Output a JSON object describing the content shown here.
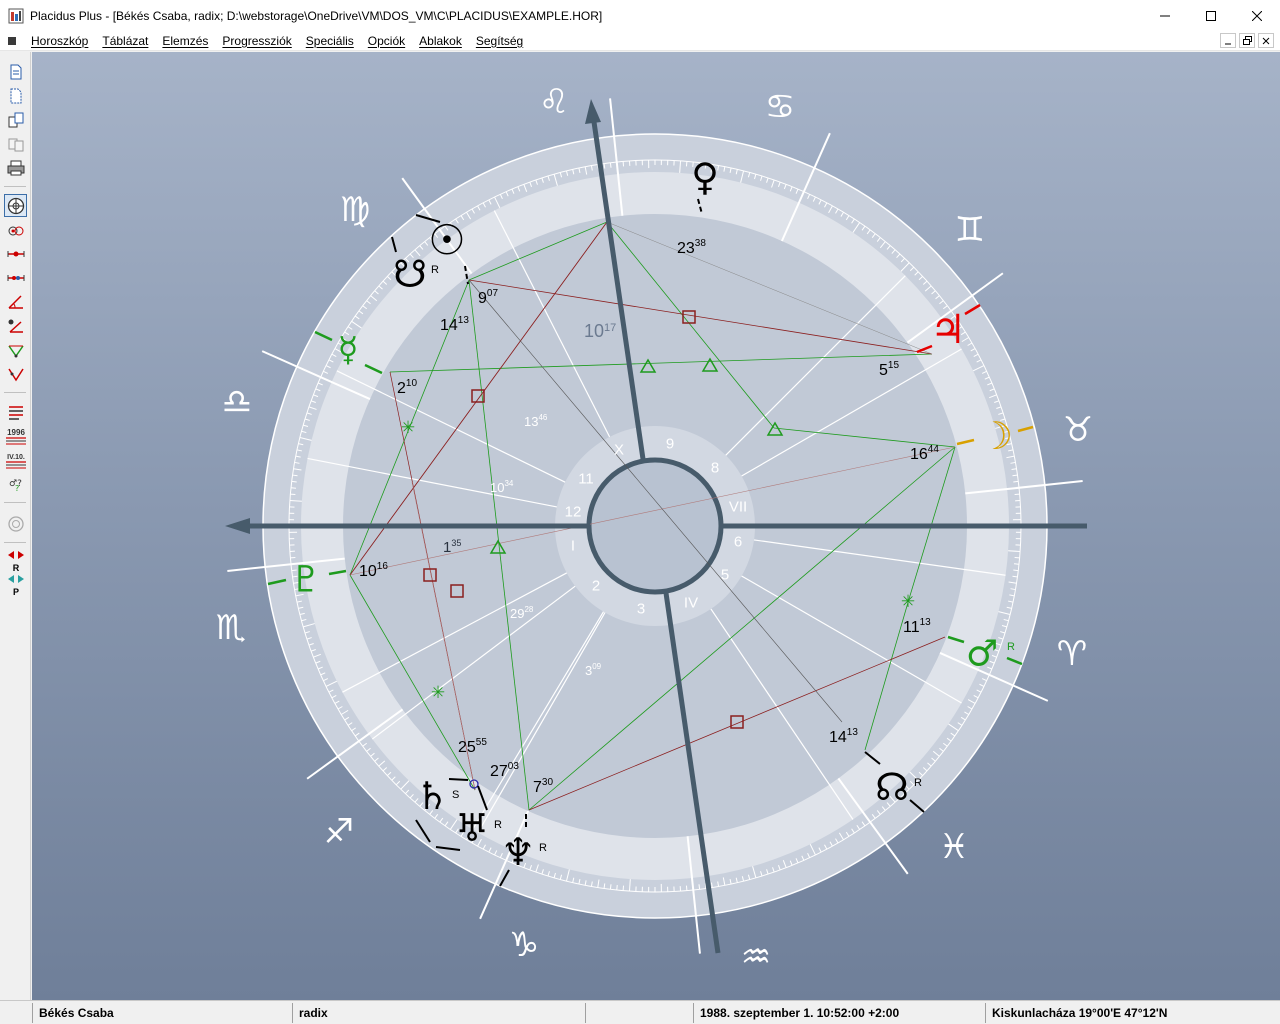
{
  "window": {
    "title": "Placidus Plus - [Békés Csaba,  radix;   D:\\webstorage\\OneDrive\\VM\\DOS_VM\\C\\PLACIDUS\\EXAMPLE.HOR]"
  },
  "menu": {
    "items": [
      "Horoszkóp",
      "Táblázat",
      "Elemzés",
      "Progressziók",
      "Speciális",
      "Opciók",
      "Ablakok",
      "Segítség"
    ]
  },
  "toolbar": {
    "label_1996": "1996",
    "label_iv10": "IV.10.",
    "label_r": "R",
    "label_p": "P"
  },
  "chart": {
    "signs": {
      "leo": "♌",
      "cancer": "♋",
      "gemini": "♊",
      "taurus": "♉",
      "aries": "♈",
      "pisces": "♓",
      "aquarius": "♒",
      "capricorn": "♑",
      "sagittarius": "♐",
      "scorpio": "♏",
      "libra": "♎",
      "virgo": "♍"
    },
    "planets": {
      "venus": "♀",
      "sun": "☉",
      "south_node": "☋",
      "mercury": "☿",
      "jupiter": "♃",
      "moon": "☽",
      "pluto": "♇",
      "mars": "♂",
      "north_node": "☊",
      "saturn": "♄",
      "uranus": "♅",
      "neptune": "♆"
    },
    "retro_marks": {
      "south_node": "R",
      "mars": "R",
      "north_node": "R",
      "uranus": "R",
      "neptune": "R",
      "saturn": "S"
    },
    "planet_degrees": {
      "venus": [
        "23",
        "38"
      ],
      "sun": [
        "9",
        "07"
      ],
      "south_node": [
        "14",
        "13"
      ],
      "mercury": [
        "2",
        "10"
      ],
      "jupiter": [
        "5",
        "15"
      ],
      "moon": [
        "16",
        "44"
      ],
      "pluto": [
        "10",
        "16"
      ],
      "mars": [
        "11",
        "13"
      ],
      "north_node": [
        "14",
        "13"
      ],
      "saturn": [
        "25",
        "55"
      ],
      "uranus": [
        "27",
        "03"
      ],
      "neptune": [
        "7",
        "30"
      ]
    },
    "house_cusp_degrees": {
      "h10": [
        "10",
        "17"
      ],
      "h11": [
        "13",
        "46"
      ],
      "h12": [
        "10",
        "34"
      ],
      "h1": [
        "1",
        "35"
      ],
      "h2": [
        "29",
        "28"
      ],
      "h3": [
        "3",
        "09"
      ]
    },
    "house_numbers": {
      "x": "X",
      "n9": "9",
      "n8": "8",
      "vii": "VII",
      "n6": "6",
      "n5": "5",
      "iv": "IV",
      "n3": "3",
      "n2": "2",
      "i": "I",
      "n12": "12",
      "n11": "11"
    },
    "colors": {
      "ring_outer": "#cfd5e0",
      "ring_inner": "#bcc4d3",
      "house_center": "#ccd3df",
      "axis": "#475b6b",
      "green": "#1e9b1e",
      "red": "#e60000",
      "gold": "#d8a000",
      "square": "#8b1f1f"
    }
  },
  "status": {
    "name": "Békés Csaba",
    "type": "radix",
    "datetime": "1988. szeptember 1.  10:52:00 +2:00",
    "location": "Kiskunlacháza  19°00'E  47°12'N"
  }
}
